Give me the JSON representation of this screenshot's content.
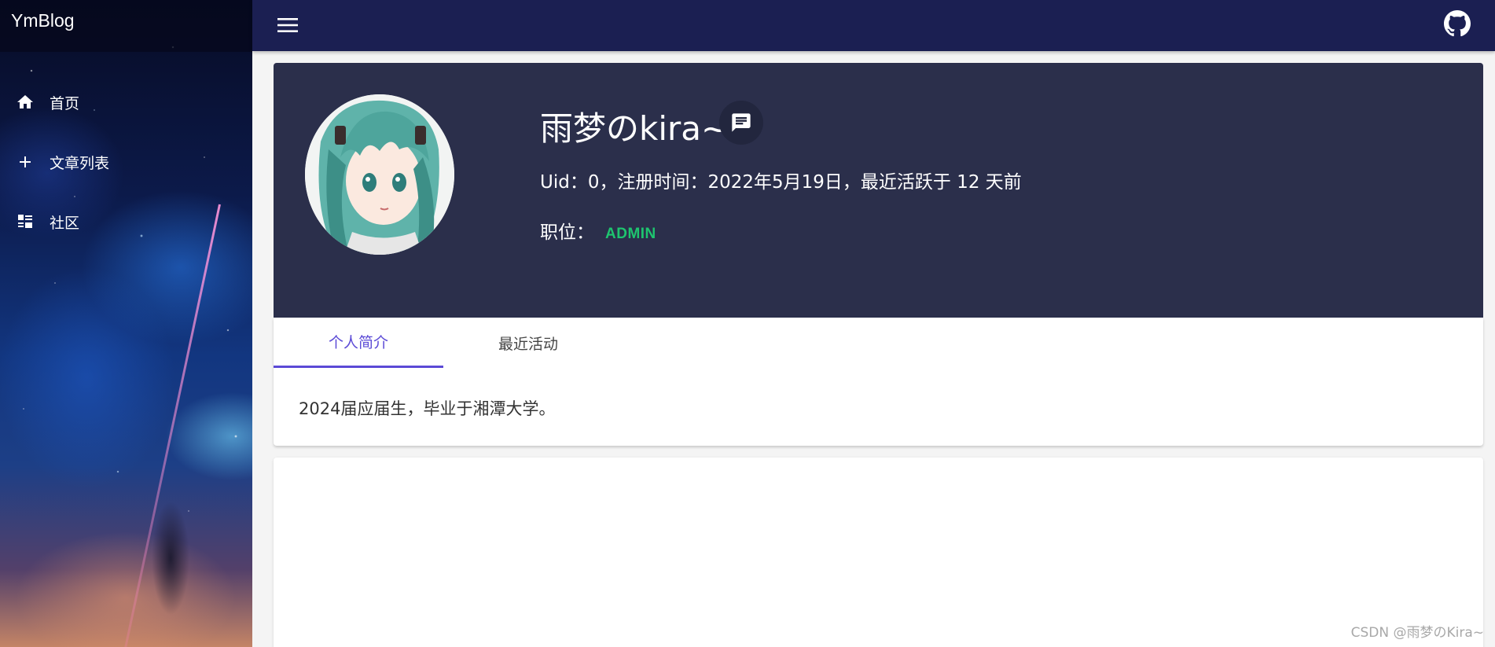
{
  "app": {
    "brand": "YmBlog"
  },
  "sidebar": {
    "items": [
      {
        "label": "首页",
        "icon": "home-icon"
      },
      {
        "label": "文章列表",
        "icon": "plus-icon"
      },
      {
        "label": "社区",
        "icon": "dashboard-list-icon"
      }
    ]
  },
  "topbar": {
    "menu_icon": "menu-icon",
    "github_icon": "github-icon"
  },
  "profile": {
    "username": "雨梦のkira~",
    "meta": "Uid：0，注册时间：2022年5月19日，最近活跃于 12 天前",
    "role_label": "职位：",
    "role_value": "ADMIN",
    "role_color": "#1ec56f",
    "avatar_icon": "avatar-image"
  },
  "tabs": [
    {
      "label": "个人简介",
      "active": true
    },
    {
      "label": "最近活动",
      "active": false
    }
  ],
  "intro_text": "2024届应届生，毕业于湘潭大学。",
  "watermark": "CSDN @雨梦のKira~",
  "colors": {
    "topbar": "#1b1f52",
    "profile_card": "#2b2f4b",
    "accent": "#5b4ad6"
  }
}
